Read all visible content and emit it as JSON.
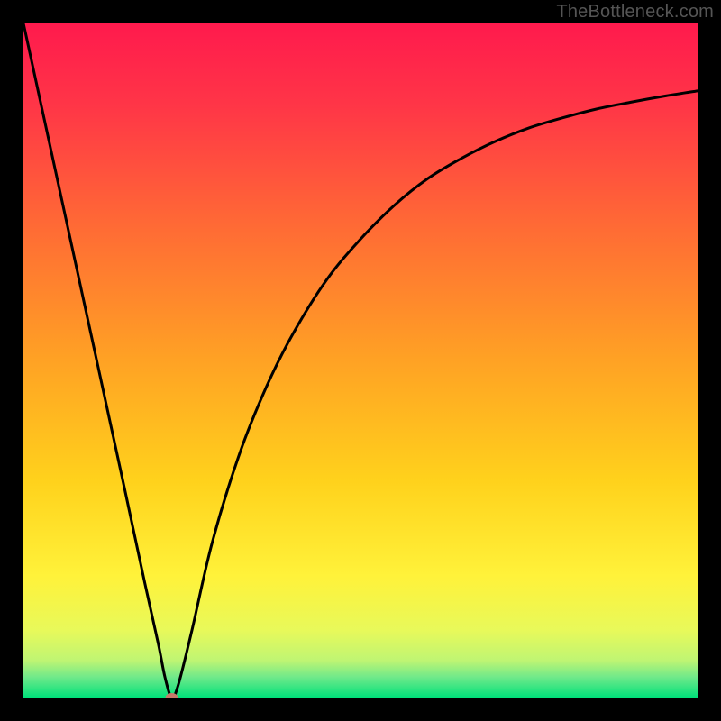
{
  "watermark": "TheBottleneck.com",
  "chart_data": {
    "type": "line",
    "title": "",
    "xlabel": "",
    "ylabel": "",
    "xlim": [
      0,
      100
    ],
    "ylim": [
      0,
      100
    ],
    "series": [
      {
        "name": "bottleneck-curve",
        "x": [
          0,
          5,
          10,
          15,
          18,
          20,
          21,
          22,
          23,
          25,
          28,
          32,
          36,
          40,
          45,
          50,
          55,
          60,
          65,
          70,
          75,
          80,
          85,
          90,
          95,
          100
        ],
        "y": [
          100,
          77,
          54,
          31,
          17,
          8,
          3,
          0,
          2,
          10,
          23,
          36,
          46,
          54,
          62,
          68,
          73,
          77,
          80,
          82.5,
          84.5,
          86,
          87.3,
          88.3,
          89.2,
          90
        ]
      }
    ],
    "marker": {
      "x": 22,
      "y": 0,
      "name": "optimal-point"
    },
    "green_band_y": [
      0,
      4
    ],
    "gradient_stops": [
      {
        "offset": 0.0,
        "color": "#ff1a4d"
      },
      {
        "offset": 0.12,
        "color": "#ff3547"
      },
      {
        "offset": 0.3,
        "color": "#ff6a35"
      },
      {
        "offset": 0.5,
        "color": "#ffa224"
      },
      {
        "offset": 0.68,
        "color": "#ffd21c"
      },
      {
        "offset": 0.82,
        "color": "#fff23a"
      },
      {
        "offset": 0.9,
        "color": "#e8f95a"
      },
      {
        "offset": 0.945,
        "color": "#bff573"
      },
      {
        "offset": 0.97,
        "color": "#6fe98a"
      },
      {
        "offset": 1.0,
        "color": "#00e17a"
      }
    ]
  }
}
